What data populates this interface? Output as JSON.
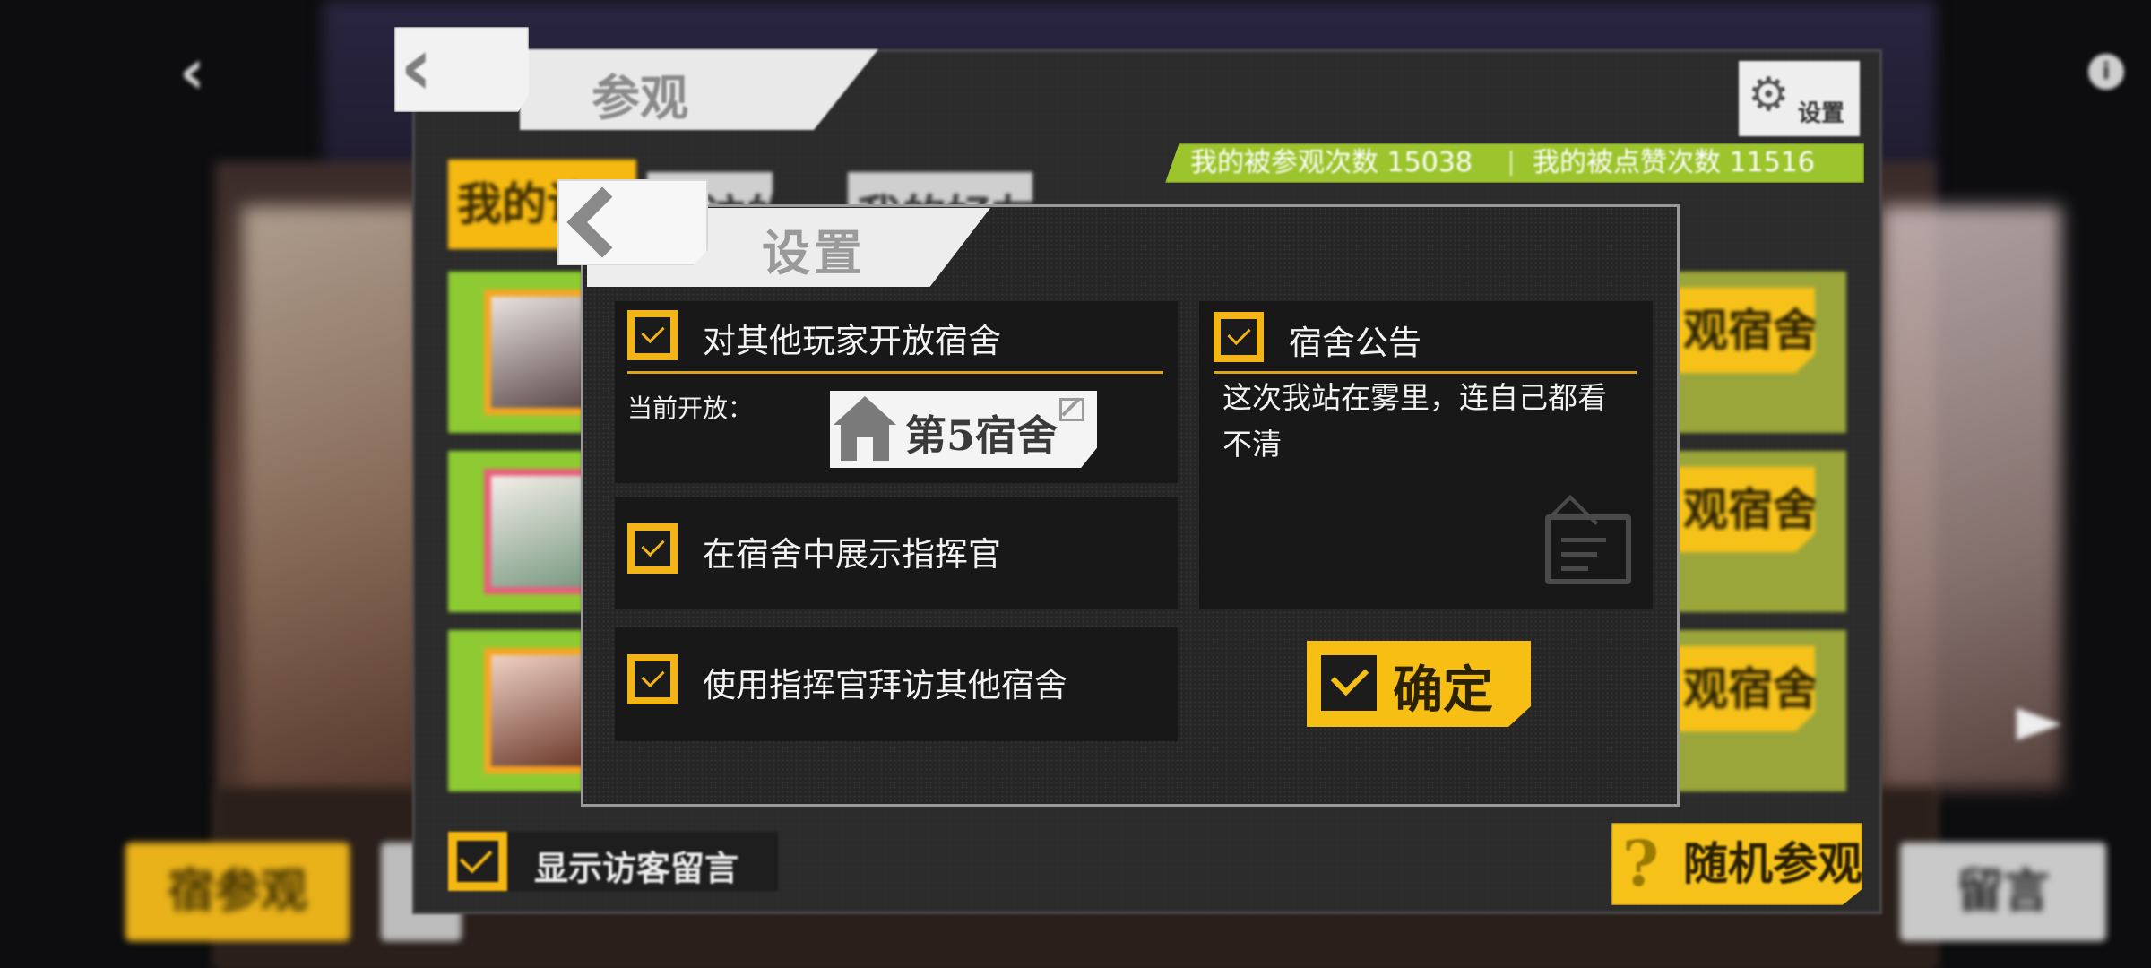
{
  "background": {
    "visit_panel": {
      "title": "参观",
      "settings_label": "设置",
      "stats": {
        "visited_label": "我的被参观次数",
        "visited_count": "15038",
        "liked_label": "我的被点赞次数",
        "liked_count": "11516"
      },
      "tabs": [
        "我的访",
        "拜访的",
        "我的好友"
      ],
      "row_button_label": "观宿舍",
      "show_messages_label": "显示访客留言",
      "random_visit_label": "随机参观"
    },
    "bottom_left_label": "宿参观",
    "bottom_right_label": "留言"
  },
  "dialog": {
    "title": "设置",
    "open_dorm_label": "对其他玩家开放宿舍",
    "current_open_label": "当前开放：",
    "current_dorm": "第5宿舍",
    "show_commander_label": "在宿舍中展示指挥官",
    "use_commander_label": "使用指挥官拜访其他宿舍",
    "notice_label": "宿舍公告",
    "notice_text": "这次我站在雾里，连自己都看不清",
    "confirm_label": "确定"
  },
  "colors": {
    "accent_yellow": "#f2b417",
    "stats_green": "#9cc42c",
    "panel_dark": "#262626"
  }
}
